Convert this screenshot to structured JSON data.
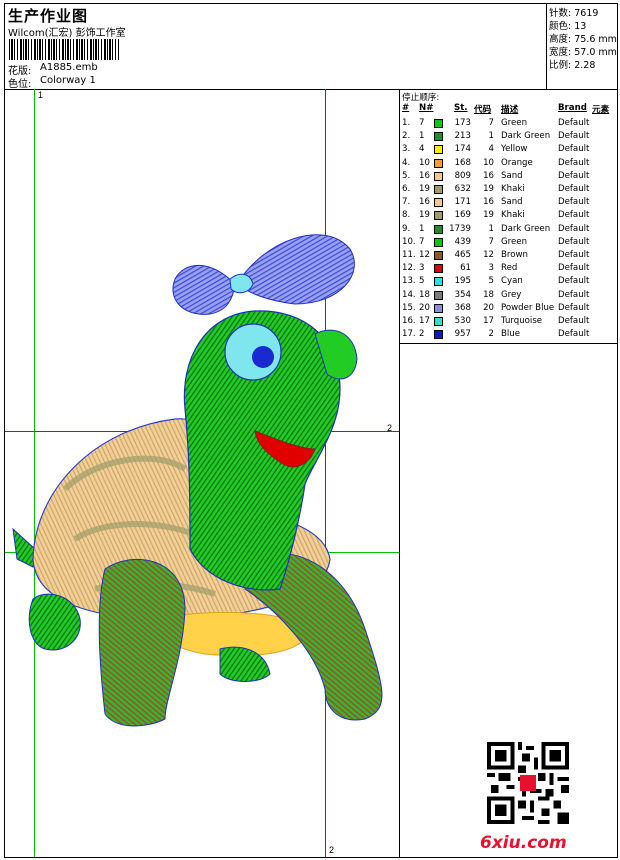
{
  "header": {
    "title": "生产作业图",
    "company": "Wilcom(汇宏) 彭饰工作室",
    "design_label": "花版:",
    "design_value": "A1885.emb",
    "colorway_label": "色位:",
    "colorway_value": "Colorway 1"
  },
  "stats": [
    {
      "label": "针数:",
      "value": "7619"
    },
    {
      "label": "颜色:",
      "value": "13"
    },
    {
      "label": "高度:",
      "value": "75.6 mm"
    },
    {
      "label": "宽度:",
      "value": "57.0 mm"
    },
    {
      "label": "比例:",
      "value": "2.28"
    }
  ],
  "guides": {
    "top_label": "1",
    "right_label": "2",
    "bottom_label": "2"
  },
  "thread_list": {
    "title": "停止顺序:",
    "headers": [
      "#",
      "N#",
      "St.",
      "代码",
      "描述",
      "Brand",
      "元素"
    ],
    "rows": [
      {
        "n": "1.",
        "needle": "7",
        "color": "#00cc00",
        "st": "173",
        "code": "7",
        "desc": "Green",
        "brand": "Default"
      },
      {
        "n": "2.",
        "needle": "1",
        "color": "#1f8f2a",
        "st": "213",
        "code": "1",
        "desc": "Dark Green",
        "brand": "Default"
      },
      {
        "n": "3.",
        "needle": "4",
        "color": "#ffee00",
        "st": "174",
        "code": "4",
        "desc": "Yellow",
        "brand": "Default"
      },
      {
        "n": "4.",
        "needle": "10",
        "color": "#ff9933",
        "st": "168",
        "code": "10",
        "desc": "Orange",
        "brand": "Default"
      },
      {
        "n": "5.",
        "needle": "16",
        "color": "#f2c88c",
        "st": "809",
        "code": "16",
        "desc": "Sand",
        "brand": "Default"
      },
      {
        "n": "6.",
        "needle": "19",
        "color": "#a09c6a",
        "st": "632",
        "code": "19",
        "desc": "Khaki",
        "brand": "Default"
      },
      {
        "n": "7.",
        "needle": "16",
        "color": "#f2c88c",
        "st": "171",
        "code": "16",
        "desc": "Sand",
        "brand": "Default"
      },
      {
        "n": "8.",
        "needle": "19",
        "color": "#a09c6a",
        "st": "169",
        "code": "19",
        "desc": "Khaki",
        "brand": "Default"
      },
      {
        "n": "9.",
        "needle": "1",
        "color": "#1f8f2a",
        "st": "1739",
        "code": "1",
        "desc": "Dark Green",
        "brand": "Default"
      },
      {
        "n": "10.",
        "needle": "7",
        "color": "#00cc00",
        "st": "439",
        "code": "7",
        "desc": "Green",
        "brand": "Default"
      },
      {
        "n": "11.",
        "needle": "12",
        "color": "#8b5a2b",
        "st": "465",
        "code": "12",
        "desc": "Brown",
        "brand": "Default"
      },
      {
        "n": "12.",
        "needle": "3",
        "color": "#e00000",
        "st": "61",
        "code": "3",
        "desc": "Red",
        "brand": "Default"
      },
      {
        "n": "13.",
        "needle": "5",
        "color": "#22e6e6",
        "st": "195",
        "code": "5",
        "desc": "Cyan",
        "brand": "Default"
      },
      {
        "n": "14.",
        "needle": "18",
        "color": "#7a7a7a",
        "st": "354",
        "code": "18",
        "desc": "Grey",
        "brand": "Default"
      },
      {
        "n": "15.",
        "needle": "20",
        "color": "#8a8ce6",
        "st": "368",
        "code": "20",
        "desc": "Powder Blue",
        "brand": "Default"
      },
      {
        "n": "16.",
        "needle": "17",
        "color": "#33e0c0",
        "st": "530",
        "code": "17",
        "desc": "Turquoise",
        "brand": "Default"
      },
      {
        "n": "17.",
        "needle": "2",
        "color": "#0a18c8",
        "st": "957",
        "code": "2",
        "desc": "Blue",
        "brand": "Default"
      }
    ]
  },
  "watermark": {
    "text": "6xiu.com",
    "color": "#e8112d"
  }
}
